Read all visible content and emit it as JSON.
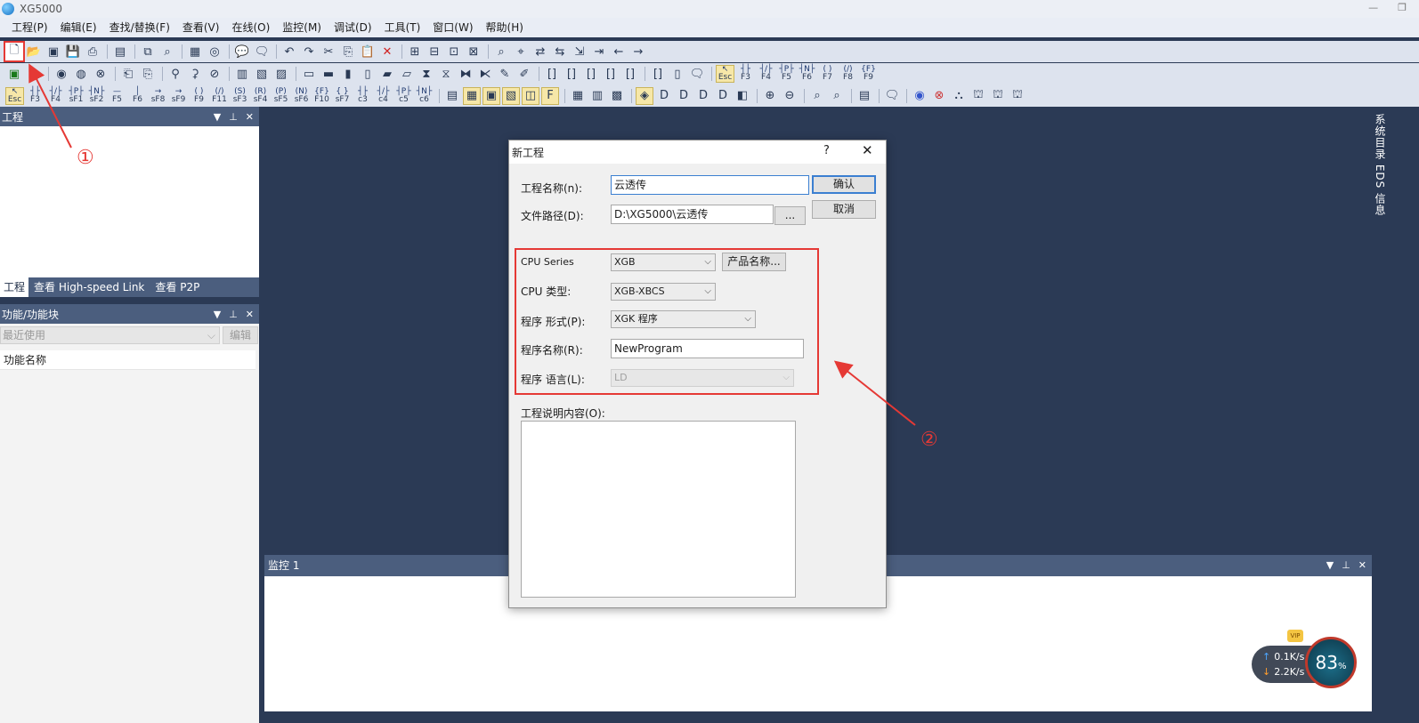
{
  "window": {
    "title": "XG5000"
  },
  "menu": [
    "工程(P)",
    "编辑(E)",
    "查找/替换(F)",
    "查看(V)",
    "在线(O)",
    "监控(M)",
    "调试(D)",
    "工具(T)",
    "窗口(W)",
    "帮助(H)"
  ],
  "fkeys": [
    {
      "sym": "↖",
      "label": "Esc"
    },
    {
      "sym": "┤├",
      "label": "F3"
    },
    {
      "sym": "┤/├",
      "label": "F4"
    },
    {
      "sym": "┤P├",
      "label": "sF1"
    },
    {
      "sym": "┤N├",
      "label": "sF2"
    },
    {
      "sym": "—",
      "label": "F5"
    },
    {
      "sym": "│",
      "label": "F6"
    },
    {
      "sym": "→",
      "label": "sF8"
    },
    {
      "sym": "→",
      "label": "sF9"
    },
    {
      "sym": "( )",
      "label": "F9"
    },
    {
      "sym": "(/)",
      "label": "F11"
    },
    {
      "sym": "(S)",
      "label": "sF3"
    },
    {
      "sym": "(R)",
      "label": "sF4"
    },
    {
      "sym": "(P)",
      "label": "sF5"
    },
    {
      "sym": "(N)",
      "label": "sF6"
    },
    {
      "sym": "{F}",
      "label": "F10"
    },
    {
      "sym": "{ }",
      "label": "sF7"
    },
    {
      "sym": "┤├",
      "label": "c3"
    },
    {
      "sym": "┤/├",
      "label": "c4"
    },
    {
      "sym": "┤P├",
      "label": "c5"
    },
    {
      "sym": "┤N├",
      "label": "c6"
    }
  ],
  "fkeys_row2": [
    {
      "sym": "↖",
      "label": "Esc"
    },
    {
      "sym": "┤├",
      "label": "F3"
    },
    {
      "sym": "┤/├",
      "label": "F4"
    },
    {
      "sym": "┤P├",
      "label": "F5"
    },
    {
      "sym": "┤N├",
      "label": "F6"
    },
    {
      "sym": "( )",
      "label": "F7"
    },
    {
      "sym": "(/)",
      "label": "F8"
    },
    {
      "sym": "{F}",
      "label": "F9"
    }
  ],
  "project_panel": {
    "title": "工程",
    "tabs": [
      "工程",
      "查看 High-speed Link",
      "查看 P2P"
    ]
  },
  "function_panel": {
    "title": "功能/功能块",
    "select_value": "最近使用",
    "edit_label": "编辑",
    "column_header": "功能名称"
  },
  "right_tabs": "系统目录  EDS 信息",
  "monitor_panel": {
    "title": "监控 1"
  },
  "dialog": {
    "title": "新工程",
    "help_glyph": "?",
    "close_glyph": "✕",
    "project_name_label": "工程名称(n):",
    "project_name_value": "云透传",
    "file_path_label": "文件路径(D):",
    "file_path_value": "D:\\XG5000\\云透传",
    "browse_label": "...",
    "ok_label": "确认",
    "cancel_label": "取消",
    "cpu_series_label": "CPU Series",
    "cpu_series_value": "XGB",
    "product_name_label": "产品名称...",
    "cpu_type_label": "CPU 类型:",
    "cpu_type_value": "XGB-XBCS",
    "program_type_label": "程序 形式(P):",
    "program_type_value": "XGK 程序",
    "program_name_label": "程序名称(R):",
    "program_name_value": "NewProgram",
    "program_lang_label": "程序 语言(L):",
    "program_lang_value": "LD",
    "description_label": "工程说明内容(O):"
  },
  "annotations": {
    "step1": "①",
    "step2": "②",
    "accent_color": "#e53935"
  },
  "net_widget": {
    "up": "0.1K/s",
    "down": "2.2K/s",
    "percent": "83",
    "percent_unit": "%",
    "badge": "VIP"
  }
}
